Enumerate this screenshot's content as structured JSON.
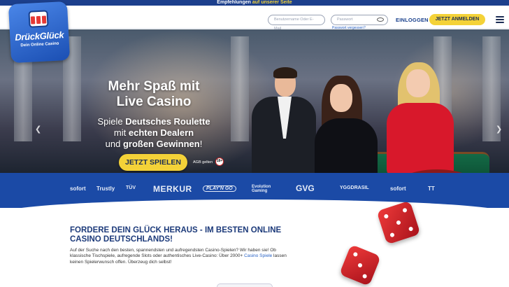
{
  "topbar": {
    "prefix": "Empfehlungen",
    "highlight": "auf unserer Seite"
  },
  "header": {
    "logo_brand": "DrückGlück",
    "logo_tag": "Dein Online Casino",
    "username_placeholder": "Benutzername Oder E-Mail",
    "password_placeholder": "Passwort",
    "forgot_label": "Passwort vergessen?",
    "login_label": "EINLOGGEN",
    "register_label": "JETZT ANMELDEN"
  },
  "hero": {
    "title_line1": "Mehr Spaß mit",
    "title_line2": "Live Casino",
    "sub_pre1": "Spiele ",
    "sub_bold1": "Deutsches Roulette",
    "sub_pre2": "mit ",
    "sub_bold2": "echten Dealern",
    "sub_pre3": "und ",
    "sub_bold3": "großen Gewinnen",
    "sub_end3": "!",
    "cta_label": "JETZT SPIELEN",
    "agb_label": "AGB gelten",
    "age_label": "18+",
    "slide_count": 8,
    "active_slide": 6
  },
  "providers": [
    "sofort",
    "Trustly",
    "TÜV",
    "MERKUR",
    "PLAY'N GO",
    "Evolution Gaming",
    "GVG",
    "YGGDRASIL",
    "sofort",
    "TT"
  ],
  "content": {
    "title": "FORDERE DEIN GLÜCK HERAUS - IM BESTEN ONLINE CASINO DEUTSCHLANDS!",
    "text_before": "Auf der Suche nach den besten, spannendsten und aufregendsten Casino-Spielen? Wir haben sie! Ob klassische Tischspiele, aufregende Slots oder authentisches Live-Casino: Über 2000+ ",
    "text_link": "Casino Spiele",
    "text_after": " lassen keinen Spielerwunsch offen. Überzeug dich selbst!"
  },
  "colors": {
    "brand_blue": "#1b4aa6",
    "accent_yellow": "#f4d238",
    "title_blue": "#1c3a7a"
  }
}
